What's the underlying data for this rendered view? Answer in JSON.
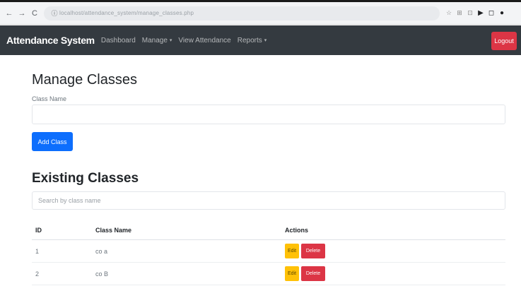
{
  "browser": {
    "url": "localhost/attendance_system/manage_classes.php",
    "icons": [
      "back-icon",
      "forward-icon",
      "reload-icon",
      "site-info-icon",
      "bookmark-icon",
      "extensions-icon",
      "media-icon",
      "window-icon",
      "profile-icon"
    ]
  },
  "navbar": {
    "brand": "Attendance System",
    "links": [
      {
        "label": "Dashboard"
      },
      {
        "label": "Manage",
        "caret": "▾"
      },
      {
        "label": "View Attendance"
      },
      {
        "label": "Reports",
        "caret": "▾"
      }
    ],
    "logout_label": "Logout"
  },
  "main": {
    "title": "Manage Classes",
    "class_name_label": "Class Name",
    "add_button": "Add Class",
    "existing_title": "Existing Classes",
    "search_placeholder": "Search by class name",
    "table": {
      "headers": [
        "ID",
        "Class Name",
        "Actions"
      ],
      "rows": [
        {
          "id": "1",
          "name": "co a",
          "edit": "Edit",
          "delete": "Delete"
        },
        {
          "id": "2",
          "name": "co B",
          "edit": "Edit",
          "delete": "Delete"
        }
      ]
    }
  },
  "colors": {
    "navbar": "#343a40",
    "primary": "#0d6efd",
    "danger": "#dc3545",
    "warning": "#ffc107"
  }
}
